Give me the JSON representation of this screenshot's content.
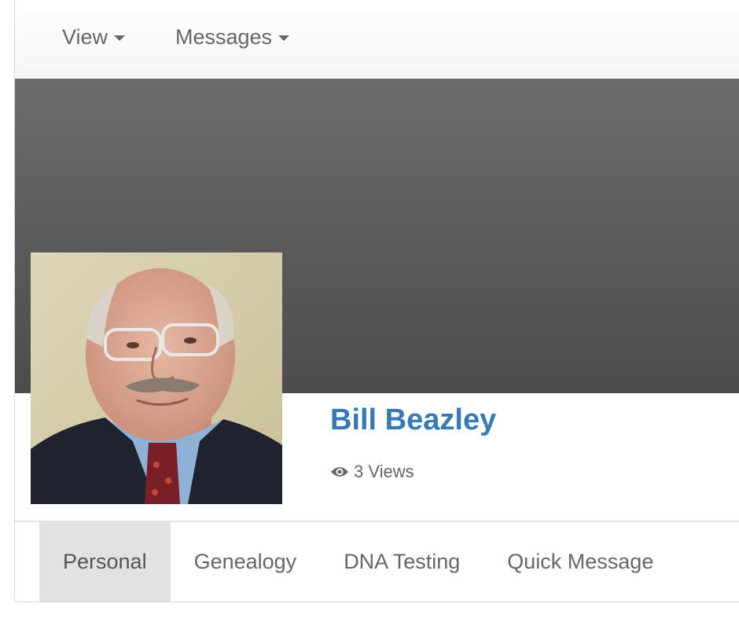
{
  "topnav": {
    "items": [
      {
        "label": "View"
      },
      {
        "label": "Messages"
      }
    ]
  },
  "profile": {
    "name": "Bill Beazley",
    "views": "3 Views"
  },
  "tabs": [
    {
      "label": "Personal",
      "active": true
    },
    {
      "label": "Genealogy"
    },
    {
      "label": "DNA Testing"
    },
    {
      "label": "Quick Message"
    }
  ],
  "colors": {
    "name_link": "#3779b4",
    "cover_top": "#6c6c6c",
    "cover_bottom": "#4c4c4c",
    "active_tab_bg": "#e2e2e2",
    "text_muted": "#666666"
  },
  "icons": {
    "view_caret": "caret-down-icon",
    "messages_caret": "caret-down-icon",
    "views": "eye-icon"
  }
}
